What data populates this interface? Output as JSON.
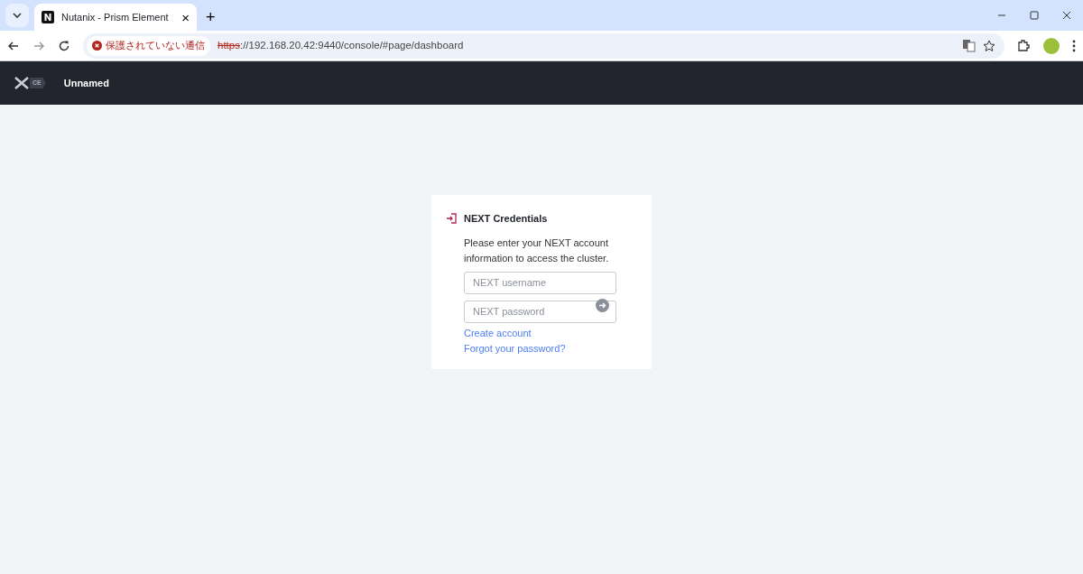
{
  "browser": {
    "tab": {
      "title": "Nutanix - Prism Element",
      "close": "×"
    },
    "new_tab": "+",
    "security_chip": "保護されていない通信",
    "url_scheme": "https",
    "url_rest": "://192.168.20.42:9440/console/#page/dashboard"
  },
  "app_header": {
    "badge": "CE",
    "cluster_name": "Unnamed"
  },
  "login_card": {
    "title": "NEXT Credentials",
    "description": "Please enter your NEXT account information to access the cluster.",
    "fields": [
      {
        "placeholder": "NEXT username",
        "submit": false
      },
      {
        "placeholder": "NEXT password",
        "submit": true
      }
    ],
    "links": [
      "Create account",
      "Forgot your password?"
    ]
  }
}
